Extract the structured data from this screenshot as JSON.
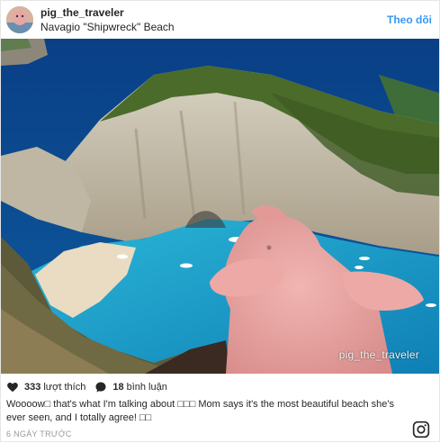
{
  "header": {
    "username": "pig_the_traveler",
    "location": "Navagio \"Shipwreck\" Beach",
    "follow_label": "Theo dõi"
  },
  "photo": {
    "watermark": "pig_the_traveler",
    "subject": "plush-pig-overlooking-navagio-beach"
  },
  "stats": {
    "likes_count": "333",
    "likes_label": "lượt thích",
    "comments_count": "18",
    "comments_label": "bình luận"
  },
  "caption": {
    "text": "Woooow□ that's what I'm talking about □□□ Mom says it's the most beautiful beach she's ever seen, and I totally agree! □□"
  },
  "timestamp": "6 NGÀY TRƯỚC",
  "icons": {
    "like": "heart-icon",
    "comment": "comment-bubble-icon",
    "brand": "instagram-icon"
  },
  "colors": {
    "link": "#3897f0",
    "sea": "#1ea3c8",
    "deep_sea": "#0d4f8a",
    "pig": "#e9a3a0"
  }
}
